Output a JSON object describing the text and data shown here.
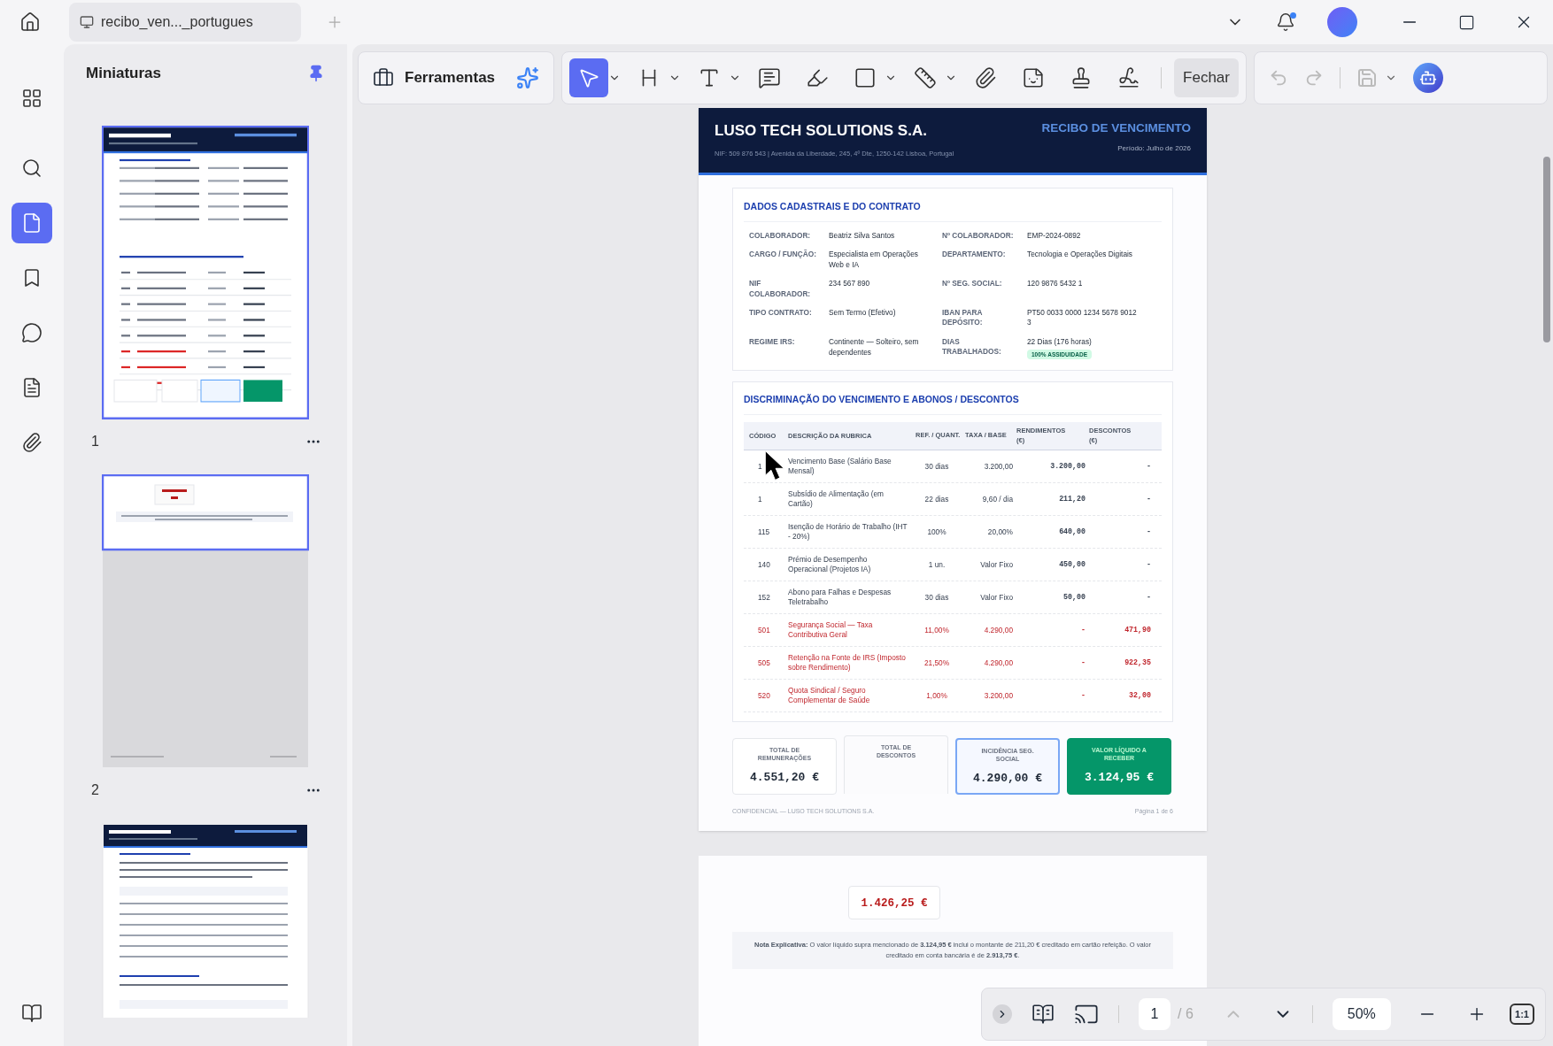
{
  "tab": {
    "title": "recibo_ven..._portugues"
  },
  "rail": {
    "items": [
      {
        "kind": "grid",
        "selected": false
      },
      {
        "kind": "search",
        "selected": false
      },
      {
        "kind": "pages",
        "selected": true
      },
      {
        "kind": "bookmarks",
        "selected": false
      },
      {
        "kind": "comments",
        "selected": false
      },
      {
        "kind": "forms",
        "selected": false
      },
      {
        "kind": "attachments",
        "selected": false
      }
    ]
  },
  "panel": {
    "title": "Miniaturas",
    "thumbnails": [
      {
        "label": "1",
        "kind": "receipt",
        "selected": true
      },
      {
        "label": "2",
        "kind": "continuation",
        "selected": true
      },
      {
        "kind": "annex",
        "selected": false
      }
    ]
  },
  "toolbar": {
    "tools_label": "Ferramentas",
    "tools": [
      {
        "kind": "select",
        "selected": true,
        "has_menu": true
      },
      {
        "kind": "heading",
        "selected": false,
        "has_menu": true
      },
      {
        "kind": "text",
        "selected": false,
        "has_menu": true
      },
      {
        "kind": "comment",
        "selected": false,
        "has_menu": false
      },
      {
        "kind": "highlight",
        "selected": false,
        "has_menu": false
      },
      {
        "kind": "shape",
        "selected": false,
        "has_menu": true
      },
      {
        "kind": "measure",
        "selected": false,
        "has_menu": true
      },
      {
        "kind": "attach",
        "selected": false,
        "has_menu": false
      },
      {
        "kind": "sticker",
        "selected": false,
        "has_menu": false
      },
      {
        "kind": "stamp",
        "selected": false,
        "has_menu": false
      },
      {
        "kind": "signature",
        "selected": false,
        "has_menu": false
      }
    ],
    "close_label": "Fechar"
  },
  "document": {
    "company": "LUSO TECH SOLUTIONS S.A.",
    "company_info": "NIF: 509 876 543 | Avenida da Liberdade, 245, 4º Dte, 1250-142 Lisboa, Portugal",
    "doc_title": "RECIBO DE VENCIMENTO",
    "period": "Período: Julho de 2026",
    "contract": {
      "title": "DADOS CADASTRAIS E DO CONTRATO",
      "rows": [
        {
          "label": "COLABORADOR:",
          "value": "Beatriz Silva Santos",
          "label2": "Nº COLABORADOR:",
          "value2": "EMP-2024-0892"
        },
        {
          "label": "CARGO / FUNÇÃO:",
          "value": "Especialista em Operações Web e IA",
          "label2": "DEPARTAMENTO:",
          "value2": "Tecnologia e Operações Digitais"
        },
        {
          "label": "NIF COLABORADOR:",
          "value": "234 567 890",
          "label2": "Nº SEG. SOCIAL:",
          "value2": "120 9876 5432 1"
        },
        {
          "label": "TIPO CONTRATO:",
          "value": "Sem Termo (Efetivo)",
          "label2": "IBAN PARA DEPÓSITO:",
          "value2": "PT50 0033 0000 1234 5678 9012 3"
        },
        {
          "label": "REGIME IRS:",
          "value": "Continente — Solteiro, sem dependentes",
          "label2": "DIAS TRABALHADOS:",
          "value2": "22 Dias (176 horas)",
          "badge": "100% ASSIDUIDADE"
        }
      ]
    },
    "breakdown": {
      "title": "DISCRIMINAÇÃO DO VENCIMENTO E ABONOS / DESCONTOS",
      "columns": [
        "CÓDIGO",
        "DESCRIÇÃO DA RUBRICA",
        "REF. / QUANT.",
        "TAXA / BASE",
        "RENDIMENTOS (€)",
        "DESCONTOS (€)"
      ],
      "rows": [
        {
          "kind": "earning",
          "code": "1",
          "description": "Vencimento Base (Salário Base Mensal)",
          "ref": "30 dias",
          "rate": "3.200,00",
          "earnings": "3.200,00",
          "deductions": "-"
        },
        {
          "kind": "earning",
          "code": "1",
          "description": "Subsídio de Alimentação (em Cartão)",
          "ref": "22 dias",
          "rate": "9,60 / dia",
          "earnings": "211,20",
          "deductions": "-"
        },
        {
          "kind": "earning",
          "code": "115",
          "description": "Isenção de Horário de Trabalho (IHT - 20%)",
          "ref": "100%",
          "rate": "20,00%",
          "earnings": "640,00",
          "deductions": "-"
        },
        {
          "kind": "earning",
          "code": "140",
          "description": "Prémio de Desempenho Operacional (Projetos IA)",
          "ref": "1 un.",
          "rate": "Valor Fixo",
          "earnings": "450,00",
          "deductions": "-"
        },
        {
          "kind": "earning",
          "code": "152",
          "description": "Abono para Falhas e Despesas Teletrabalho",
          "ref": "30 dias",
          "rate": "Valor Fixo",
          "earnings": "50,00",
          "deductions": "-"
        },
        {
          "kind": "deduction",
          "code": "501",
          "description": "Segurança Social — Taxa Contributiva Geral",
          "ref": "11,00%",
          "rate": "4.290,00",
          "earnings": "-",
          "deductions": "471,90"
        },
        {
          "kind": "deduction",
          "code": "505",
          "description": "Retenção na Fonte de IRS (Imposto sobre Rendimento)",
          "ref": "21,50%",
          "rate": "4.290,00",
          "earnings": "-",
          "deductions": "922,35"
        },
        {
          "kind": "deduction",
          "code": "520",
          "description": "Quota Sindical / Seguro Complementar de Saúde",
          "ref": "1,00%",
          "rate": "3.200,00",
          "earnings": "-",
          "deductions": "32,00"
        }
      ]
    },
    "totals": [
      {
        "kind": "plain",
        "label": "TOTAL DE REMUNERAÇÕES",
        "value": "4.551,20 €"
      },
      {
        "kind": "split",
        "label": "TOTAL DE DESCONTOS"
      },
      {
        "kind": "outline",
        "label": "INCIDÊNCIA SEG. SOCIAL",
        "value": "4.290,00 €"
      },
      {
        "kind": "highlight",
        "label": "VALOR LÍQUIDO A RECEBER",
        "value": "3.124,95 €"
      }
    ],
    "footer_left": "CONFIDENCIAL — LUSO TECH SOLUTIONS S.A.",
    "footer_right": "Página 1 de 6",
    "page2": {
      "carried_value": "1.426,25 €",
      "note": "**Nota Explicativa:** O valor líquido supra mencionado de **3.124,95 €** inclui o montante de 211,20 € creditado em cartão refeição. O valor creditado em conta bancária é de **2.913,75 €**."
    }
  },
  "navigation": {
    "page": "1",
    "total": "/ 6",
    "zoom": "50%",
    "actual_size": "1:1"
  }
}
